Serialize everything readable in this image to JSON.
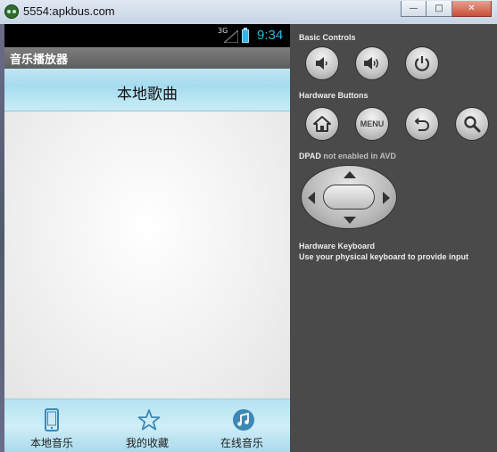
{
  "window": {
    "title": "5554:apkbus.com",
    "minimize_glyph": "—",
    "maximize_glyph": "□",
    "close_glyph": "✕",
    "app_icon": "android-emulator-icon"
  },
  "statusbar": {
    "network": "3G",
    "time": "9:34",
    "icons": [
      "signal-icon",
      "battery-charging-icon"
    ],
    "accent_color": "#33b5e5"
  },
  "app": {
    "title": "音乐播放器",
    "header_title": "本地歌曲",
    "bottom_nav": [
      {
        "label": "本地音乐",
        "icon": "phone-icon"
      },
      {
        "label": "我的收藏",
        "icon": "star-icon"
      },
      {
        "label": "在线音乐",
        "icon": "music-note-icon"
      }
    ]
  },
  "emulator": {
    "basic_controls_label": "Basic Controls",
    "basic_controls": [
      "volume-down-icon",
      "volume-up-icon",
      "power-icon"
    ],
    "hardware_buttons_label": "Hardware Buttons",
    "hardware_buttons": [
      "home-icon",
      "menu-button",
      "back-icon",
      "search-icon"
    ],
    "menu_label": "MENU",
    "dpad_label": "DPAD",
    "dpad_note": "not enabled in AVD",
    "keyboard_label": "Hardware Keyboard",
    "keyboard_note": "Use your physical keyboard to provide input"
  }
}
